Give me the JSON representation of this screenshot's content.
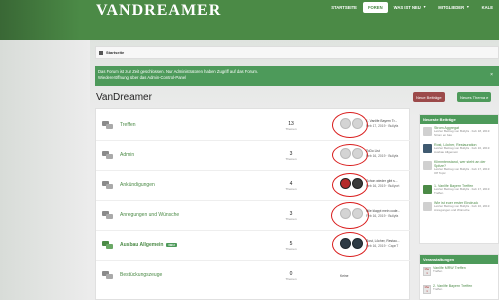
{
  "header": {
    "logo": "VANDREAMER",
    "nav": [
      {
        "label": "STARTSEITE",
        "active": false
      },
      {
        "label": "FOREN",
        "active": true
      },
      {
        "label": "WAS IST NEU",
        "active": false,
        "dropdown": true
      },
      {
        "label": "MITGLIEDER",
        "active": false,
        "dropdown": true
      },
      {
        "label": "KALE",
        "active": false
      }
    ]
  },
  "breadcrumb": {
    "label": "Startseite"
  },
  "notice": {
    "line1": "Das Forum ist zur Zeit geschlossen. Nur Administratoren haben Zugriff auf das Forum.",
    "line2": "Wiedereröffnung über das Admin-Control-Panel",
    "close": "×"
  },
  "main": {
    "title": "VanDreamer",
    "btn_new_posts": "Neue Beiträge",
    "btn_new_thread": "Neues Thema e"
  },
  "forums": [
    {
      "name": "Treffen",
      "count": "13",
      "count_label": "Themen",
      "latest_title": "1. Vanlife Bayern Tr...",
      "latest_meta": "Feb 17, 2019 · Bullyfa",
      "avatars": [
        "default",
        "default"
      ]
    },
    {
      "name": "Admin",
      "count": "3",
      "count_label": "Themen",
      "latest_title": "ToDo List",
      "latest_meta": "Feb 16, 2019 · Bullyfa",
      "avatars": [
        "default",
        "default"
      ]
    },
    {
      "name": "Ankündigungen",
      "count": "4",
      "count_label": "Themen",
      "latest_title": "Schon wieder gibt s...",
      "latest_meta": "Feb 16, 2019 · Bullyort",
      "avatars": [
        "car-red",
        "car"
      ]
    },
    {
      "name": "Anregungen und Wünsche",
      "count": "3",
      "count_label": "Themen",
      "latest_title": "Wie klappt mein code...",
      "latest_meta": "Feb 16, 2019 · Bullyfa",
      "avatars": [
        "default",
        "default"
      ]
    },
    {
      "name": "Ausbau Allgemein",
      "badge": "NEU",
      "count": "5",
      "count_label": "Themen",
      "latest_title": "Rost, Löcher, Restau...",
      "latest_meta": "Feb 16, 2019 · CapnT",
      "avatars": [
        "dark",
        "dark"
      ]
    },
    {
      "name": "Bestückungszeuge",
      "count": "0",
      "count_label": "Themen",
      "latest_title": "Keine",
      "latest_meta": "",
      "avatars": []
    }
  ],
  "sidebar": {
    "head": "Neueste Beiträge",
    "items": [
      {
        "title": "Strom Aggregat",
        "meta": "Letzter Beitrag von Bullyfa · Feb 18, 2019",
        "sub": "Strom en bau"
      },
      {
        "title": "Rost, Löcher, Restauration",
        "meta": "Letzter Beitrag von Bullyfa · Feb 16, 2019",
        "sub": "Ausbau Allgemein"
      },
      {
        "title": "Klimmtenstand, wer steht an der Spitze?",
        "meta": "Letzter Beitrag von Bullyfa · Feb 17, 2019",
        "sub": "Off Topic"
      },
      {
        "title": "1. Vanlife Bayern Treffen",
        "meta": "Letzter Beitrag von Bullyfa · Feb 17, 2019",
        "sub": "Treffen"
      },
      {
        "title": "Wie ist euer erster Eindruck",
        "meta": "Letzter Beitrag von Bullyfa · Feb 16, 2019",
        "sub": "Anregungen und Wünsche"
      }
    ]
  },
  "events": {
    "head": "Veranstaltungen",
    "items": [
      {
        "month": "Mar",
        "day": "1",
        "title": "Vanlife MRW Treffen",
        "meta": "Treffen"
      },
      {
        "month": "Mar",
        "day": "1",
        "title": "2. Vanlife Bayern Treffen",
        "meta": "Treffen"
      }
    ]
  }
}
